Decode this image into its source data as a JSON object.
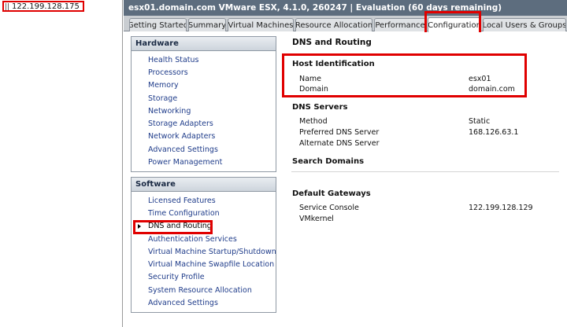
{
  "inventory": {
    "host_ip": "122.199.128.175"
  },
  "window": {
    "title": "esx01.domain.com VMware ESX, 4.1.0, 260247 | Evaluation (60 days remaining)"
  },
  "tabs": [
    {
      "label": "Getting Started"
    },
    {
      "label": "Summary"
    },
    {
      "label": "Virtual Machines"
    },
    {
      "label": "Resource Allocation"
    },
    {
      "label": "Performance"
    },
    {
      "label": "Configuration",
      "active": true
    },
    {
      "label": "Local Users & Groups"
    }
  ],
  "hardware": {
    "header": "Hardware",
    "items": [
      {
        "label": "Health Status"
      },
      {
        "label": "Processors"
      },
      {
        "label": "Memory"
      },
      {
        "label": "Storage"
      },
      {
        "label": "Networking"
      },
      {
        "label": "Storage Adapters"
      },
      {
        "label": "Network Adapters"
      },
      {
        "label": "Advanced Settings"
      },
      {
        "label": "Power Management"
      }
    ]
  },
  "software": {
    "header": "Software",
    "items": [
      {
        "label": "Licensed Features"
      },
      {
        "label": "Time Configuration"
      },
      {
        "label": "DNS and Routing",
        "selected": true
      },
      {
        "label": "Authentication Services"
      },
      {
        "label": "Virtual Machine Startup/Shutdown"
      },
      {
        "label": "Virtual Machine Swapfile Location"
      },
      {
        "label": "Security Profile"
      },
      {
        "label": "System Resource Allocation"
      },
      {
        "label": "Advanced Settings"
      }
    ]
  },
  "detail": {
    "title": "DNS and Routing",
    "host_identification": {
      "title": "Host Identification",
      "name_label": "Name",
      "name_value": "esx01",
      "domain_label": "Domain",
      "domain_value": "domain.com"
    },
    "dns_servers": {
      "title": "DNS Servers",
      "method_label": "Method",
      "method_value": "Static",
      "preferred_label": "Preferred DNS Server",
      "preferred_value": "168.126.63.1",
      "alternate_label": "Alternate DNS Server",
      "alternate_value": ""
    },
    "search_domains": {
      "title": "Search Domains"
    },
    "default_gateways": {
      "title": "Default Gateways",
      "console_label": "Service Console",
      "console_value": "122.199.128.129",
      "vmkernel_label": "VMkernel",
      "vmkernel_value": ""
    }
  },
  "colors": {
    "highlight": "#e00000",
    "title_bar": "#5d6d7e",
    "link": "#1f3c8a"
  }
}
